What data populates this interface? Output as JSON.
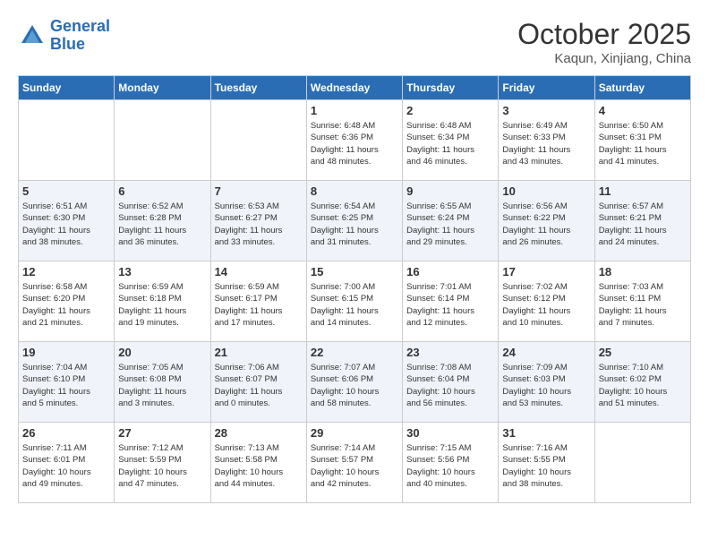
{
  "header": {
    "logo_line1": "General",
    "logo_line2": "Blue",
    "month": "October 2025",
    "location": "Kaqun, Xinjiang, China"
  },
  "days_of_week": [
    "Sunday",
    "Monday",
    "Tuesday",
    "Wednesday",
    "Thursday",
    "Friday",
    "Saturday"
  ],
  "weeks": [
    [
      {
        "day": "",
        "info": ""
      },
      {
        "day": "",
        "info": ""
      },
      {
        "day": "",
        "info": ""
      },
      {
        "day": "1",
        "info": "Sunrise: 6:48 AM\nSunset: 6:36 PM\nDaylight: 11 hours\nand 48 minutes."
      },
      {
        "day": "2",
        "info": "Sunrise: 6:48 AM\nSunset: 6:34 PM\nDaylight: 11 hours\nand 46 minutes."
      },
      {
        "day": "3",
        "info": "Sunrise: 6:49 AM\nSunset: 6:33 PM\nDaylight: 11 hours\nand 43 minutes."
      },
      {
        "day": "4",
        "info": "Sunrise: 6:50 AM\nSunset: 6:31 PM\nDaylight: 11 hours\nand 41 minutes."
      }
    ],
    [
      {
        "day": "5",
        "info": "Sunrise: 6:51 AM\nSunset: 6:30 PM\nDaylight: 11 hours\nand 38 minutes."
      },
      {
        "day": "6",
        "info": "Sunrise: 6:52 AM\nSunset: 6:28 PM\nDaylight: 11 hours\nand 36 minutes."
      },
      {
        "day": "7",
        "info": "Sunrise: 6:53 AM\nSunset: 6:27 PM\nDaylight: 11 hours\nand 33 minutes."
      },
      {
        "day": "8",
        "info": "Sunrise: 6:54 AM\nSunset: 6:25 PM\nDaylight: 11 hours\nand 31 minutes."
      },
      {
        "day": "9",
        "info": "Sunrise: 6:55 AM\nSunset: 6:24 PM\nDaylight: 11 hours\nand 29 minutes."
      },
      {
        "day": "10",
        "info": "Sunrise: 6:56 AM\nSunset: 6:22 PM\nDaylight: 11 hours\nand 26 minutes."
      },
      {
        "day": "11",
        "info": "Sunrise: 6:57 AM\nSunset: 6:21 PM\nDaylight: 11 hours\nand 24 minutes."
      }
    ],
    [
      {
        "day": "12",
        "info": "Sunrise: 6:58 AM\nSunset: 6:20 PM\nDaylight: 11 hours\nand 21 minutes."
      },
      {
        "day": "13",
        "info": "Sunrise: 6:59 AM\nSunset: 6:18 PM\nDaylight: 11 hours\nand 19 minutes."
      },
      {
        "day": "14",
        "info": "Sunrise: 6:59 AM\nSunset: 6:17 PM\nDaylight: 11 hours\nand 17 minutes."
      },
      {
        "day": "15",
        "info": "Sunrise: 7:00 AM\nSunset: 6:15 PM\nDaylight: 11 hours\nand 14 minutes."
      },
      {
        "day": "16",
        "info": "Sunrise: 7:01 AM\nSunset: 6:14 PM\nDaylight: 11 hours\nand 12 minutes."
      },
      {
        "day": "17",
        "info": "Sunrise: 7:02 AM\nSunset: 6:12 PM\nDaylight: 11 hours\nand 10 minutes."
      },
      {
        "day": "18",
        "info": "Sunrise: 7:03 AM\nSunset: 6:11 PM\nDaylight: 11 hours\nand 7 minutes."
      }
    ],
    [
      {
        "day": "19",
        "info": "Sunrise: 7:04 AM\nSunset: 6:10 PM\nDaylight: 11 hours\nand 5 minutes."
      },
      {
        "day": "20",
        "info": "Sunrise: 7:05 AM\nSunset: 6:08 PM\nDaylight: 11 hours\nand 3 minutes."
      },
      {
        "day": "21",
        "info": "Sunrise: 7:06 AM\nSunset: 6:07 PM\nDaylight: 11 hours\nand 0 minutes."
      },
      {
        "day": "22",
        "info": "Sunrise: 7:07 AM\nSunset: 6:06 PM\nDaylight: 10 hours\nand 58 minutes."
      },
      {
        "day": "23",
        "info": "Sunrise: 7:08 AM\nSunset: 6:04 PM\nDaylight: 10 hours\nand 56 minutes."
      },
      {
        "day": "24",
        "info": "Sunrise: 7:09 AM\nSunset: 6:03 PM\nDaylight: 10 hours\nand 53 minutes."
      },
      {
        "day": "25",
        "info": "Sunrise: 7:10 AM\nSunset: 6:02 PM\nDaylight: 10 hours\nand 51 minutes."
      }
    ],
    [
      {
        "day": "26",
        "info": "Sunrise: 7:11 AM\nSunset: 6:01 PM\nDaylight: 10 hours\nand 49 minutes."
      },
      {
        "day": "27",
        "info": "Sunrise: 7:12 AM\nSunset: 5:59 PM\nDaylight: 10 hours\nand 47 minutes."
      },
      {
        "day": "28",
        "info": "Sunrise: 7:13 AM\nSunset: 5:58 PM\nDaylight: 10 hours\nand 44 minutes."
      },
      {
        "day": "29",
        "info": "Sunrise: 7:14 AM\nSunset: 5:57 PM\nDaylight: 10 hours\nand 42 minutes."
      },
      {
        "day": "30",
        "info": "Sunrise: 7:15 AM\nSunset: 5:56 PM\nDaylight: 10 hours\nand 40 minutes."
      },
      {
        "day": "31",
        "info": "Sunrise: 7:16 AM\nSunset: 5:55 PM\nDaylight: 10 hours\nand 38 minutes."
      },
      {
        "day": "",
        "info": ""
      }
    ]
  ]
}
